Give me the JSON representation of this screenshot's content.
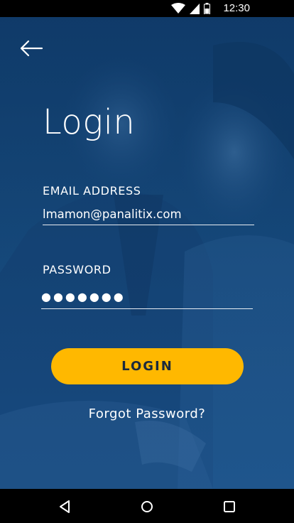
{
  "status_bar": {
    "time": "12:30",
    "icons": [
      "wifi-icon",
      "cellular-signal-icon",
      "battery-icon"
    ]
  },
  "header": {
    "back_icon": "arrow-left-icon"
  },
  "login_form": {
    "title": "Login",
    "email": {
      "label": "EMAIL ADDRESS",
      "value": "lmamon@panalitix.com"
    },
    "password": {
      "label": "PASSWORD",
      "value": "●●●●●●●"
    },
    "submit_label": "LOGIN",
    "forgot_label": "Forgot Password?"
  },
  "nav_bar": {
    "icons": [
      "nav-back-icon",
      "nav-home-icon",
      "nav-recents-icon"
    ]
  },
  "colors": {
    "background_tint": "#0f3b6a",
    "accent": "#ffb800",
    "button_text": "#1b2a3d",
    "text": "#ffffff"
  }
}
